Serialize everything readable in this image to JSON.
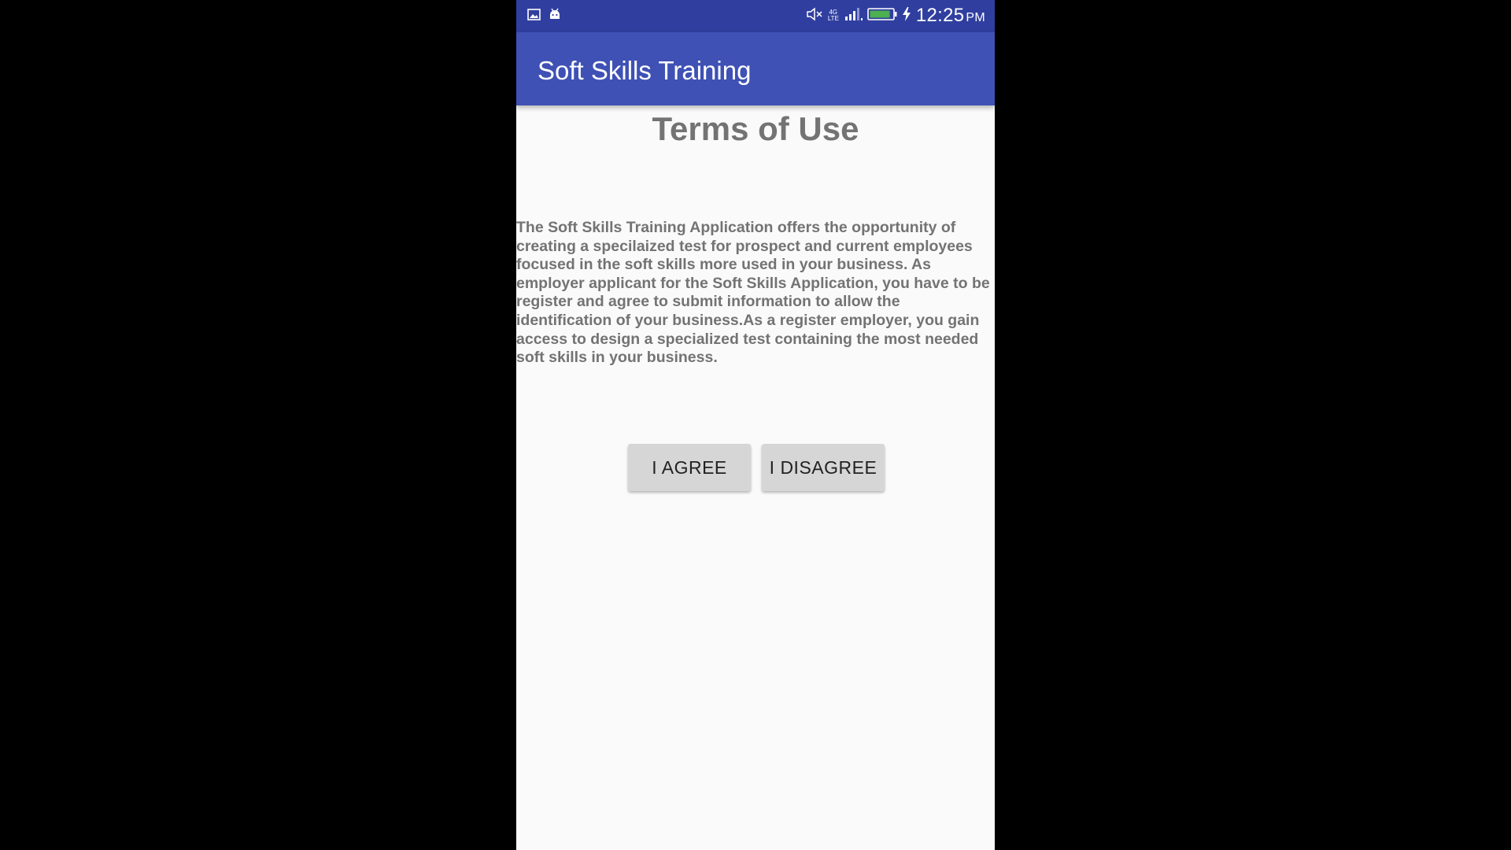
{
  "status_bar": {
    "time": "12:25",
    "ampm": "PM",
    "network_top": "4G",
    "network_bottom": "LTE",
    "icons": [
      "image-icon",
      "android-icon",
      "mute-icon",
      "signal-icon",
      "battery-icon",
      "charging-icon"
    ],
    "background": "#303f9f"
  },
  "app_bar": {
    "title": "Soft Skills Training",
    "background": "#3f51b5"
  },
  "content": {
    "title": "Terms of Use",
    "body": "The Soft Skills Training Application offers the opportunity of creating a specilaized test for prospect and current employees focused in the soft skills more used in your business. As employer applicant for the Soft Skills Application, you have to be register and agree to submit information to allow the identification of your business.As a register employer, you gain access to design a specialized test containing the most needed soft skills in your business."
  },
  "buttons": {
    "agree_label": "I AGREE",
    "disagree_label": "I DISAGREE",
    "background": "#d6d6d6"
  }
}
